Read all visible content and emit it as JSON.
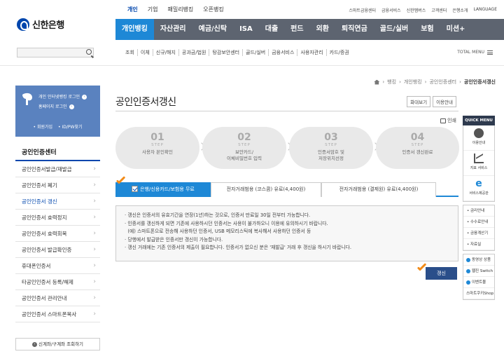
{
  "header": {
    "logo_text": "신한은행",
    "tier1": [
      "개인",
      "기업",
      "패밀리뱅킹",
      "오픈뱅킹"
    ],
    "util": [
      "스마트금융센터",
      "금융서비스",
      "신한멤버스",
      "고객센터",
      "은행소개",
      "LANGUAGE"
    ],
    "gnb": [
      "개인뱅킹",
      "자산관리",
      "예금/신탁",
      "ISA",
      "대출",
      "펀드",
      "외환",
      "퇴직연금",
      "골드/실버",
      "보험",
      "미션+"
    ],
    "subnav": [
      "조회",
      "이체",
      "신규/해지",
      "공과금/법원",
      "탕감보안센터",
      "골드/실버",
      "금융서비스",
      "사용자관리",
      "카드/증권"
    ],
    "total_menu": "TOTAL MENU"
  },
  "sidebar": {
    "login_line1": "개인 인터넷뱅킹 로그인",
    "login_line2": "홈페이지 로그인",
    "join": "• 회원가입",
    "find": "• ID/PW찾기",
    "title": "공인인증센터",
    "items": [
      "공인인증서발급/재발급",
      "공인인증서 폐기",
      "공인인증서 갱신",
      "공인인증서 효력정지",
      "공인인증서 효력회복",
      "공인인증서 발급확인증",
      "휴대폰인증서",
      "타공인인증서 등록/해제",
      "공인인증서 관리안내",
      "공인인증서 스마트폰복사"
    ],
    "lookup_btn": "신계좌/구계좌 조회하기"
  },
  "breadcrumb": [
    "뱅킹",
    "개인뱅킹",
    "공인인증센터",
    "공인인증서갱신"
  ],
  "page_title": "공인인증서갱신",
  "title_buttons": [
    "화대보기",
    "이용안내"
  ],
  "print_label": "인쇄",
  "steps": [
    {
      "num": "01",
      "label": "STEP",
      "text": "사용자 본인확인"
    },
    {
      "num": "02",
      "label": "STEP",
      "text": "보안카드/\n이체비밀번호 입력"
    },
    {
      "num": "03",
      "label": "STEP",
      "text": "인증서암호 및\n저장위치선정"
    },
    {
      "num": "04",
      "label": "STEP",
      "text": "인증서 갱신완료"
    }
  ],
  "tabs": [
    "은행/신용카드/보험용 무료",
    "전자거래범용 (코스콤) 유료(4,400원)",
    "전자거래범용 (결제원) 유료(4,400원)"
  ],
  "notices": [
    "· 갱신은 인증서의 유효기간을 연장(1년)하는 것으로, 인증서 만료일 30일 전부터 가능합니다.",
    "· 인증서를 갱신하게 되면 기존에 사용하시던 인증서는 사용이 불가하오니 이용에 유의하시기 바랍니다.",
    "  (예) 스마트폰으로 전송해 사용하던 인증서, USB 메모리스틱에 복사해서 사용하던 인증서 등",
    "· 당행에서 발급받은 인증서만 갱신이 가능합니다.",
    "· 갱신 거래에는 기존 인증서의 제출이 필요합니다. 인증서가 없으신 분은 '재발급' 거래 후 갱신을 하시기 바랍니다."
  ],
  "renew_button": "갱신",
  "quick": {
    "head": "QUICK MENU",
    "icons": [
      {
        "name": "headset-icon",
        "label": "이용안내"
      },
      {
        "name": "chart-icon",
        "label": "지표 서비스"
      },
      {
        "name": "ie-icon",
        "label": "서비스제공관"
      }
    ],
    "links": [
      "금리안내",
      "수수료안내",
      "금융계산기",
      "자료실"
    ],
    "promos": [
      "동영상 상품",
      "웹진 Switch",
      "이벤트몰",
      "스마트쿠키Shop"
    ]
  },
  "colors": {
    "gnb_bg": "#5d6470",
    "gnb_active": "#1e88d6",
    "brand": "#0046ad",
    "button": "#2a4e8a",
    "cursor": "#f28c1a"
  }
}
